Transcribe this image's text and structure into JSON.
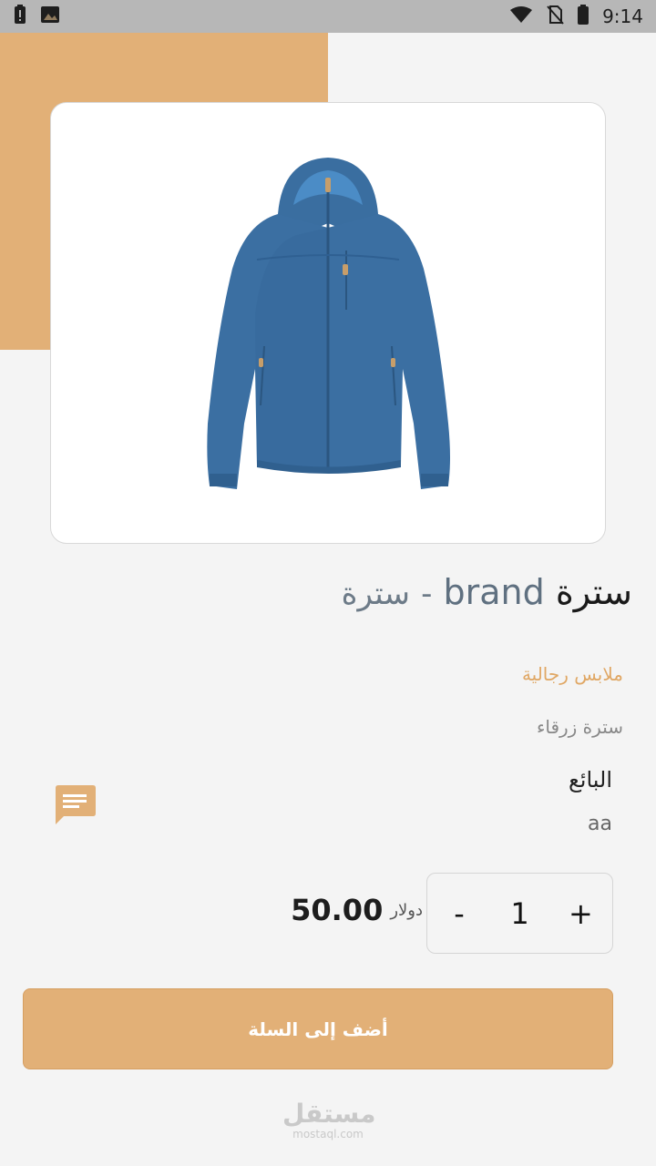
{
  "status_bar": {
    "time": "9:14",
    "icons": [
      "battery-alert-icon",
      "image-icon",
      "wifi-icon",
      "no-sim-icon",
      "battery-icon"
    ]
  },
  "product": {
    "image_alt": "blue-jacket",
    "title_main": "سترة",
    "title_brand": "brand",
    "title_sep": "-",
    "title_sub": "سترة",
    "category": "ملابس رجالية",
    "description": "سترة زرقاء",
    "seller_label": "البائع",
    "seller_name": "aa",
    "price": "50.00",
    "currency": "دولار"
  },
  "quantity": {
    "minus": "-",
    "value": "1",
    "plus": "+"
  },
  "actions": {
    "add_to_cart": "أضف إلى السلة"
  },
  "watermark": {
    "arabic": "مستقل",
    "latin": "mostaql.com"
  },
  "colors": {
    "accent": "#e2b077",
    "category_text": "#e0a764",
    "status_bar": "#b7b7b7"
  }
}
